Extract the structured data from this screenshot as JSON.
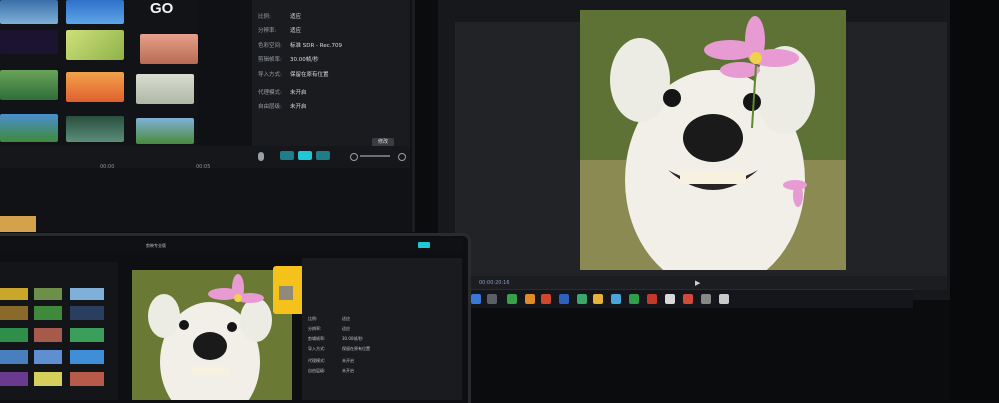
{
  "left_monitor": {
    "logo_text": "GO",
    "props": [
      {
        "key": "比例:",
        "value": "适应"
      },
      {
        "key": "分辨率:",
        "value": "适应"
      },
      {
        "key": "色彩空间:",
        "value": "标准 SDR - Rec.709"
      },
      {
        "key": "剪辑帧率:",
        "value": "30.00帧/秒"
      },
      {
        "key": "导入方式:",
        "value": "保留在原有位置"
      },
      {
        "key": "代理模式:",
        "value": "未开启"
      },
      {
        "key": "自由层级:",
        "value": "未开启"
      }
    ],
    "edit_button": "修改",
    "timeline_ticks": [
      "00:00",
      "00:05"
    ]
  },
  "right_monitor": {
    "time_readout": "00:00:20:16"
  },
  "laptop": {
    "title": "剪映专业版",
    "props": [
      "比例:",
      "分辨率:",
      "剪辑帧率:",
      "导入方式:",
      "代理模式:",
      "自由层级:"
    ],
    "values": [
      "适应",
      "适应",
      "30.00帧/秒",
      "保留在原有位置",
      "未开启",
      "未开启"
    ]
  },
  "colors": {
    "accent_cyan": "#1fc8d8",
    "popup_yellow": "#f4c21a",
    "taskbar_bg": "#14161b"
  }
}
